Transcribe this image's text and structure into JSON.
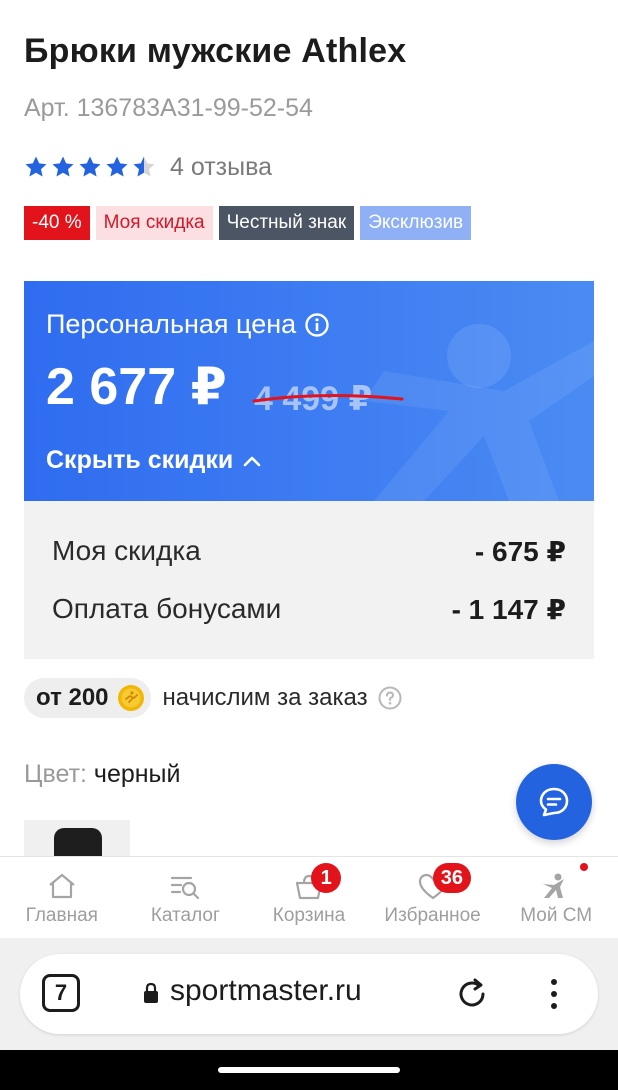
{
  "product": {
    "title": "Брюки мужские Athlex",
    "article": "Арт. 136783A31-99-52-54",
    "rating": 4.5,
    "reviews": "4 отзыва"
  },
  "badges": {
    "discount": "-40 %",
    "my_discount": "Моя скидка",
    "honest_sign": "Честный знак",
    "exclusive": "Эксклюзив"
  },
  "price_card": {
    "label": "Персональная цена",
    "price": "2 677 ₽",
    "old_price": "4 499 ₽",
    "hide_label": "Скрыть скидки",
    "colors": {
      "bg_from": "#2f6cf0",
      "bg_to": "#4a8bf3",
      "strike": "#e3131b"
    }
  },
  "discounts": [
    {
      "label": "Моя скидка",
      "value": "- 675 ₽"
    },
    {
      "label": "Оплата бонусами",
      "value": "- 1 147 ₽"
    }
  ],
  "bonus": {
    "amount": "от 200",
    "text": "начислим за заказ"
  },
  "color": {
    "key": "Цвет:",
    "value": "черный"
  },
  "tabbar": {
    "items": [
      {
        "label": "Главная",
        "icon": "home-icon"
      },
      {
        "label": "Каталог",
        "icon": "catalog-search-icon"
      },
      {
        "label": "Корзина",
        "icon": "cart-icon",
        "badge": "1"
      },
      {
        "label": "Избранное",
        "icon": "heart-icon",
        "badge": "36"
      },
      {
        "label": "Мой СМ",
        "icon": "profile-runner-icon"
      }
    ]
  },
  "browser": {
    "tab_count": "7",
    "url": "sportmaster.ru"
  },
  "accent_colors": {
    "brand_blue": "#2463e0",
    "sale_red": "#e3131b"
  }
}
